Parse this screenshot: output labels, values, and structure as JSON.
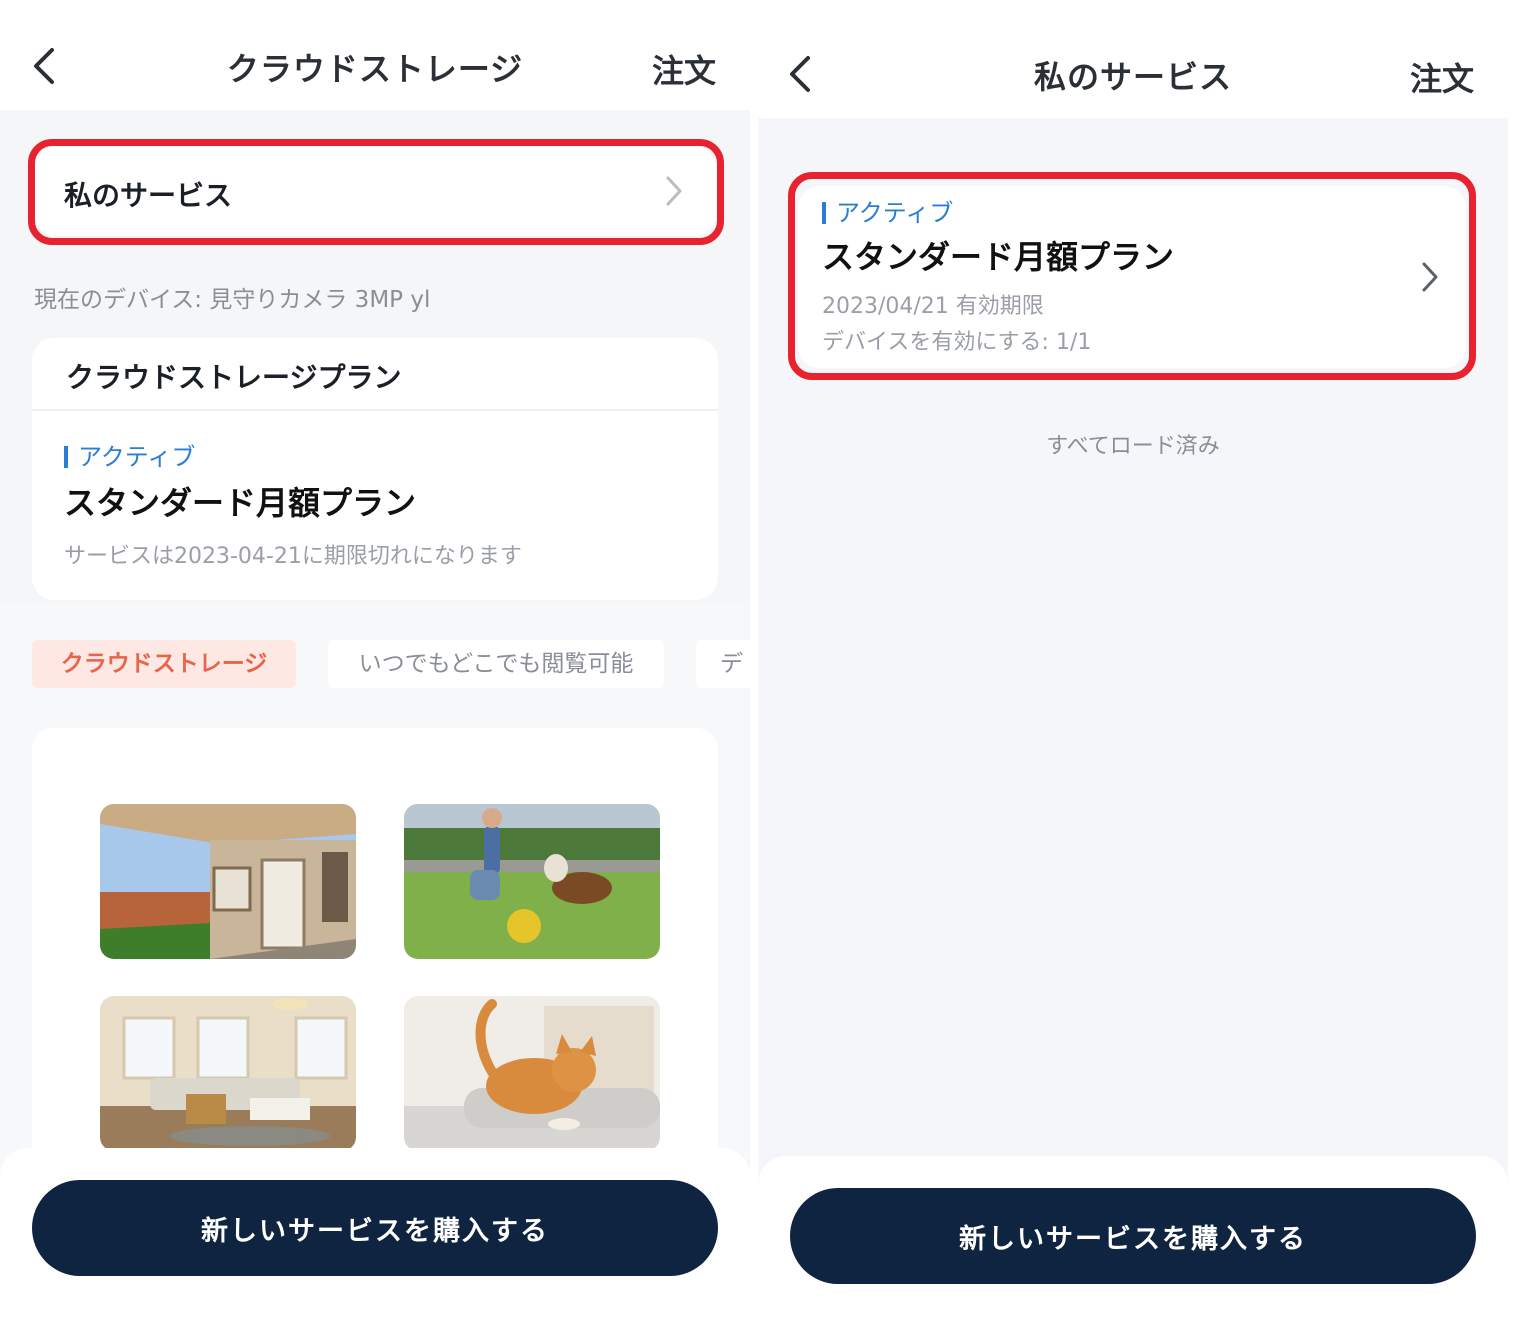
{
  "left": {
    "header": {
      "title": "クラウドストレージ",
      "order": "注文"
    },
    "my_service": {
      "label": "私のサービス"
    },
    "current_device": "現在のデバイス: 見守りカメラ 3MP yl",
    "plan_card": {
      "heading": "クラウドストレージプラン",
      "status": "アクティブ",
      "plan_name": "スタンダード月額プラン",
      "expiry_note": "サービスは2023-04-21に期限切れになります"
    },
    "tabs": [
      "クラウドストレージ",
      "いつでもどこでも閲覧可能",
      "デ"
    ],
    "buy_button": "新しいサービスを購入する"
  },
  "right": {
    "header": {
      "title": "私のサービス",
      "order": "注文"
    },
    "service_card": {
      "status": "アクティブ",
      "plan_name": "スタンダード月額プラン",
      "expiry": "2023/04/21 有効期限",
      "devices": "デバイスを有効にする: 1/1"
    },
    "all_loaded": "すべてロード済み",
    "buy_button": "新しいサービスを購入する"
  },
  "colors": {
    "accent": "#e6232e",
    "status_blue": "#2a7fd4",
    "button": "#0f2440",
    "tab_active_bg": "#fde8e3",
    "tab_active_text": "#e8644a"
  }
}
